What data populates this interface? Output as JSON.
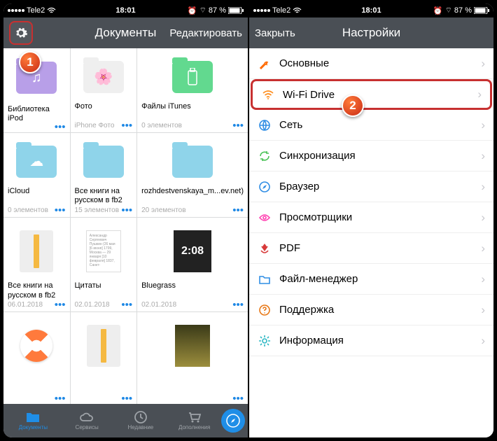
{
  "status": {
    "carrier": "Tele2",
    "time": "18:01",
    "battery": "87 %"
  },
  "left": {
    "nav": {
      "title": "Документы",
      "right": "Редактировать"
    },
    "docs": [
      {
        "title": "Библиотека iPod",
        "sub": "",
        "thumb": "folder-purple-music"
      },
      {
        "title": "Фото",
        "sub": "iPhone Фото",
        "thumb": "folder-white-photo"
      },
      {
        "title": "Файлы iTunes",
        "sub": "0 элементов",
        "thumb": "folder-green-usb"
      },
      {
        "title": "iCloud",
        "sub": "0 элементов",
        "thumb": "folder-blue-cloud"
      },
      {
        "title": "Все книги на русском в fb2",
        "sub": "15 элементов",
        "thumb": "folder-blue"
      },
      {
        "title": "rozhdestvenskaya_m...ev.net)",
        "sub": "20 элементов",
        "thumb": "folder-blue"
      },
      {
        "title": "Все книги на русском в fb2",
        "sub": "06.01.2018",
        "thumb": "zip"
      },
      {
        "title": "Цитаты",
        "sub": "02.01.2018",
        "thumb": "txt"
      },
      {
        "title": "Bluegrass",
        "sub": "02.01.2018",
        "thumb": "img-time",
        "imgText": "2:08"
      },
      {
        "title": "",
        "sub": "",
        "thumb": "lifesaver"
      },
      {
        "title": "",
        "sub": "",
        "thumb": "zip"
      },
      {
        "title": "",
        "sub": "",
        "thumb": "mona"
      }
    ],
    "tabs": [
      {
        "label": "Документы",
        "icon": "folder",
        "active": true
      },
      {
        "label": "Сервисы",
        "icon": "cloud"
      },
      {
        "label": "Недавние",
        "icon": "clock"
      },
      {
        "label": "Дополнения",
        "icon": "cart"
      },
      {
        "label": "",
        "icon": "compass"
      }
    ]
  },
  "right": {
    "nav": {
      "left": "Закрыть",
      "title": "Настройки"
    },
    "rows": [
      {
        "label": "Основные",
        "icon": "wrench",
        "color": "#ff6a00"
      },
      {
        "label": "Wi-Fi Drive",
        "icon": "wifi",
        "color": "#ff8c1a",
        "hl": true
      },
      {
        "label": "Сеть",
        "icon": "globe",
        "color": "#2f8de4"
      },
      {
        "label": "Синхронизация",
        "icon": "sync",
        "color": "#48c255"
      },
      {
        "label": "Браузер",
        "icon": "compass",
        "color": "#2f8de4"
      },
      {
        "label": "Просмотрщики",
        "icon": "eye",
        "color": "#ff3fb0"
      },
      {
        "label": "PDF",
        "icon": "pdf",
        "color": "#d83a3a"
      },
      {
        "label": "Файл-менеджер",
        "icon": "folder",
        "color": "#2f8de4"
      },
      {
        "label": "Поддержка",
        "icon": "help",
        "color": "#e87816"
      },
      {
        "label": "Информация",
        "icon": "gear",
        "color": "#2fb8c4"
      }
    ]
  },
  "badges": {
    "b1": "1",
    "b2": "2"
  }
}
